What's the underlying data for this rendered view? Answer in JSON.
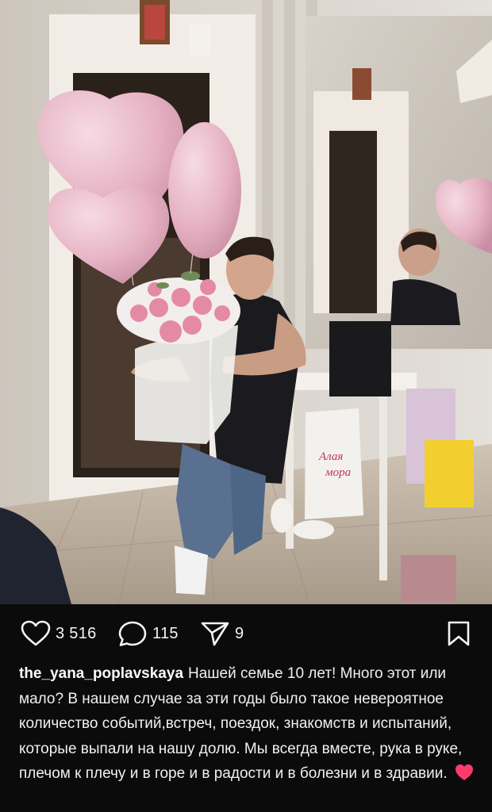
{
  "post": {
    "likes": "3 516",
    "comments": "115",
    "shares": "9"
  },
  "caption": {
    "username": "the_yana_poplavskaya",
    "text": "Нашей семье 10 лет! Много этот или мало? В нашем случае за эти годы было такое невероятное количество событий,встреч, поездок, знакомств и испытаний, которые выпали на нашу долю. Мы всегда вместе, рука в руке, плечом к плечу и в горе и в радости и в болезни и в здравии."
  },
  "photo": {
    "bag_text_line1": "Алая",
    "bag_text_line2": "мора"
  },
  "colors": {
    "background": "#0b0b0c",
    "text": "#f0f0f0",
    "emoji_heart": "#ff3b6b",
    "balloon_pink": "#e9b7c7"
  },
  "icons": [
    "heart-icon",
    "comment-icon",
    "share-icon",
    "bookmark-icon",
    "red-heart-emoji"
  ]
}
